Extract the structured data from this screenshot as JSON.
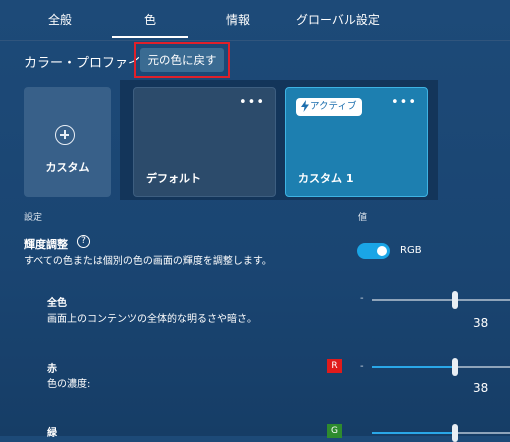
{
  "tabs": [
    {
      "label": "全般",
      "active": false
    },
    {
      "label": "色",
      "active": true
    },
    {
      "label": "情報",
      "active": false
    },
    {
      "label": "グローバル設定",
      "active": false
    }
  ],
  "profile": {
    "label": "カラー・プロファイル",
    "revert_button": "元の色に戻す"
  },
  "cards": {
    "add_custom": "カスタム",
    "default": {
      "name": "デフォルト",
      "menu": "•••"
    },
    "custom1": {
      "name": "カスタム 1",
      "badge": "アクティブ",
      "menu": "•••"
    }
  },
  "columns": {
    "setting": "設定",
    "value": "値"
  },
  "brightness": {
    "title": "輝度調整",
    "help": "?",
    "description": "すべての色または個別の色の画面の輝度を調整します。",
    "toggle_on": true,
    "toggle_label": "RGB"
  },
  "items": [
    {
      "title": "全色",
      "description": "画面上のコンテンツの全体的な明るさや暗さ。",
      "minus": "-",
      "value": "38",
      "fill_fraction": 0.0
    },
    {
      "title": "赤",
      "description": "色の濃度:",
      "minus": "-",
      "value": "38",
      "channel": "R",
      "channel_color": "#e01b1b",
      "fill_fraction": 0.6
    },
    {
      "title": "緑",
      "channel": "G",
      "channel_color": "#2e8b2e",
      "fill_fraction": 0.6
    }
  ],
  "colors": {
    "accent": "#1aa5e6",
    "highlight_border": "#e0202a"
  }
}
